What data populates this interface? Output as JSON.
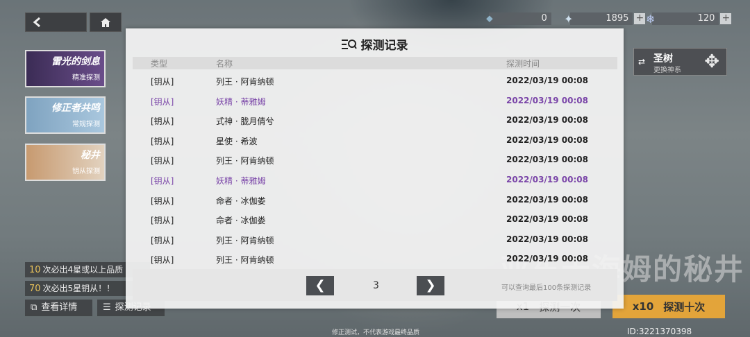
{
  "currency": [
    {
      "value": "0",
      "icon": "ticket-icon"
    },
    {
      "value": "1895",
      "icon": "star-crystal-icon"
    },
    {
      "value": "120",
      "icon": "snowflake-crystal-icon"
    }
  ],
  "banners": [
    {
      "title": "雷光的剑息",
      "subtitle": "精准探测"
    },
    {
      "title": "修正者共鸣",
      "subtitle": "常规探测"
    },
    {
      "title": "秘井",
      "subtitle": "钥从探测"
    }
  ],
  "info": {
    "row1_num": "10",
    "row1_text": "次必出4星或以上品质",
    "row2_num": "70",
    "row2_text": "次必出5星钥从！！",
    "details_label": "查看详情",
    "records_label": "探测记录"
  },
  "tree": {
    "title": "圣树",
    "subtitle": "更换神系"
  },
  "big_title": "亚东天海姆的秘井",
  "actions": {
    "x1_label": "x1",
    "x1_action": "探测一次",
    "x10_label": "x10",
    "x10_action": "探测十次"
  },
  "user_id": "ID:3221370398",
  "footer_note": "修正测试，不代表游戏最终品质",
  "modal": {
    "title": "探测记录",
    "headers": {
      "type": "类型",
      "name": "名称",
      "time": "探测时间"
    },
    "rows": [
      {
        "type": "[钥从]",
        "name": "列王 · 阿肯纳顿",
        "time": "2022/03/19 00:08",
        "highlight": false
      },
      {
        "type": "[钥从]",
        "name": "妖精 · 蒂雅姆",
        "time": "2022/03/19 00:08",
        "highlight": true
      },
      {
        "type": "[钥从]",
        "name": "式神 · 胧月倩兮",
        "time": "2022/03/19 00:08",
        "highlight": false
      },
      {
        "type": "[钥从]",
        "name": "星使 · 希波",
        "time": "2022/03/19 00:08",
        "highlight": false
      },
      {
        "type": "[钥从]",
        "name": "列王 · 阿肯纳顿",
        "time": "2022/03/19 00:08",
        "highlight": false
      },
      {
        "type": "[钥从]",
        "name": "妖精 · 蒂雅姆",
        "time": "2022/03/19 00:08",
        "highlight": true
      },
      {
        "type": "[钥从]",
        "name": "命者 · 冰伽娄",
        "time": "2022/03/19 00:08",
        "highlight": false
      },
      {
        "type": "[钥从]",
        "name": "命者 · 冰伽娄",
        "time": "2022/03/19 00:08",
        "highlight": false
      },
      {
        "type": "[钥从]",
        "name": "列王 · 阿肯纳顿",
        "time": "2022/03/19 00:08",
        "highlight": false
      },
      {
        "type": "[钥从]",
        "name": "列王 · 阿肯纳顿",
        "time": "2022/03/19 00:08",
        "highlight": false
      }
    ],
    "prev_label": "❮",
    "next_label": "❯",
    "page": "3",
    "page_note": "可以查询最后100条探测记录"
  },
  "colors": {
    "highlight": "#7a45a8",
    "accent": "#e3a43a"
  }
}
